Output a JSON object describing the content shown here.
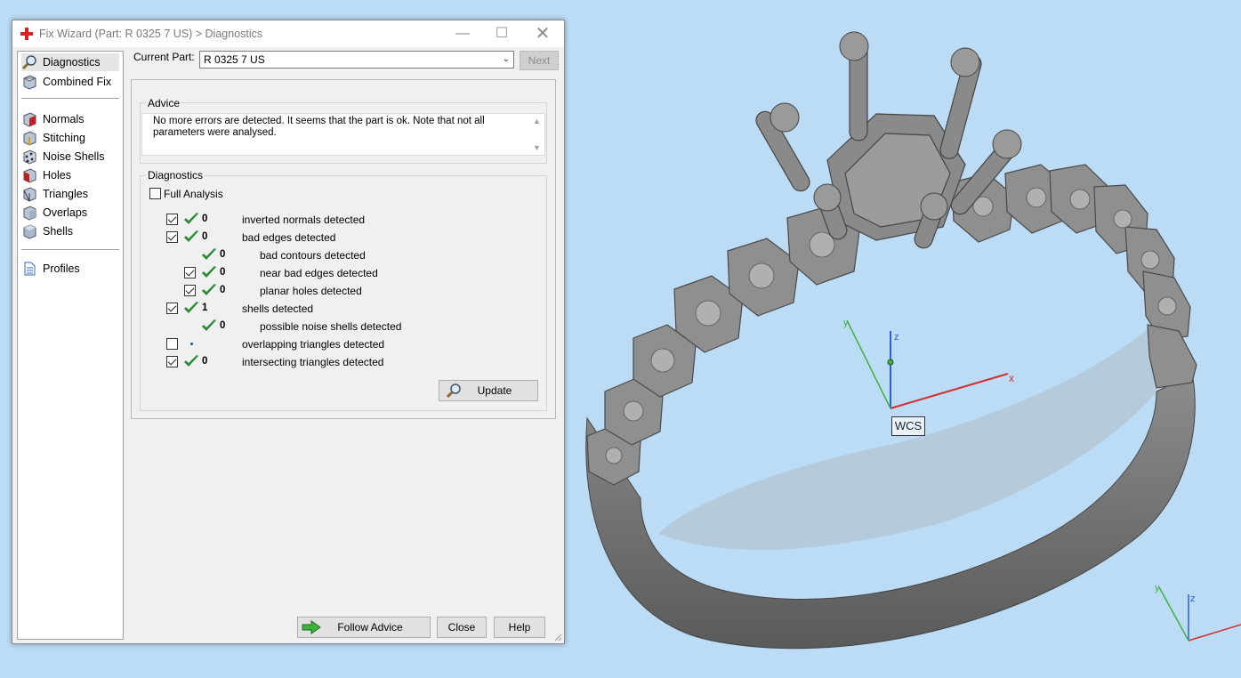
{
  "window": {
    "title": "Fix Wizard (Part: R 0325 7 US) > Diagnostics"
  },
  "sidebar": {
    "items": [
      {
        "label": "Diagnostics",
        "icon": "magnifier-icon"
      },
      {
        "label": "Combined Fix",
        "icon": "cube-icon"
      },
      {
        "label": "Normals",
        "icon": "normals-cube-icon"
      },
      {
        "label": "Stitching",
        "icon": "stitching-cube-icon"
      },
      {
        "label": "Noise Shells",
        "icon": "noise-shells-icon"
      },
      {
        "label": "Holes",
        "icon": "holes-cube-icon"
      },
      {
        "label": "Triangles",
        "icon": "triangles-cube-icon"
      },
      {
        "label": "Overlaps",
        "icon": "overlaps-cube-icon"
      },
      {
        "label": "Shells",
        "icon": "shells-cube-icon"
      },
      {
        "label": "Profiles",
        "icon": "document-icon"
      }
    ]
  },
  "current_part": {
    "label": "Current Part:",
    "value": "R 0325 7 US",
    "next_label": "Next"
  },
  "advice": {
    "caption": "Advice",
    "text": "No more errors are detected. It seems that the part is ok. Note that not all parameters were analysed."
  },
  "diagnostics": {
    "caption": "Diagnostics",
    "full_analysis_label": "Full Analysis",
    "full_analysis_checked": false,
    "rows": [
      {
        "checked": true,
        "has_checkbox": true,
        "status": "ok",
        "count": "0",
        "text": "inverted normals detected",
        "indent": 0
      },
      {
        "checked": true,
        "has_checkbox": true,
        "status": "ok",
        "count": "0",
        "text": "bad edges detected",
        "indent": 0
      },
      {
        "checked": false,
        "has_checkbox": false,
        "status": "ok",
        "count": "0",
        "text": "bad contours detected",
        "indent": 1
      },
      {
        "checked": true,
        "has_checkbox": true,
        "status": "ok",
        "count": "0",
        "text": "near bad edges detected",
        "indent": 1
      },
      {
        "checked": true,
        "has_checkbox": true,
        "status": "ok",
        "count": "0",
        "text": "planar holes detected",
        "indent": 1
      },
      {
        "checked": true,
        "has_checkbox": true,
        "status": "ok",
        "count": "1",
        "text": "shells detected",
        "indent": 0
      },
      {
        "checked": false,
        "has_checkbox": false,
        "status": "ok",
        "count": "0",
        "text": "possible noise shells detected",
        "indent": 1
      },
      {
        "checked": false,
        "has_checkbox": true,
        "status": "none",
        "count": "",
        "text": "overlapping triangles detected",
        "indent": 0
      },
      {
        "checked": true,
        "has_checkbox": true,
        "status": "ok",
        "count": "0",
        "text": "intersecting triangles detected",
        "indent": 0
      }
    ],
    "update_label": "Update"
  },
  "footer": {
    "follow_advice_label": "Follow Advice",
    "close_label": "Close",
    "help_label": "Help"
  },
  "viewport": {
    "wcs_label": "WCS",
    "axis_x": "x",
    "axis_y": "y",
    "axis_z": "z"
  },
  "colors": {
    "viewport_bg": "#bcdcf6",
    "ok_check": "#2e8b3a",
    "x_axis": "#d03030",
    "y_axis": "#40b040",
    "z_axis": "#3060d0",
    "title_icon": "#e02020"
  }
}
